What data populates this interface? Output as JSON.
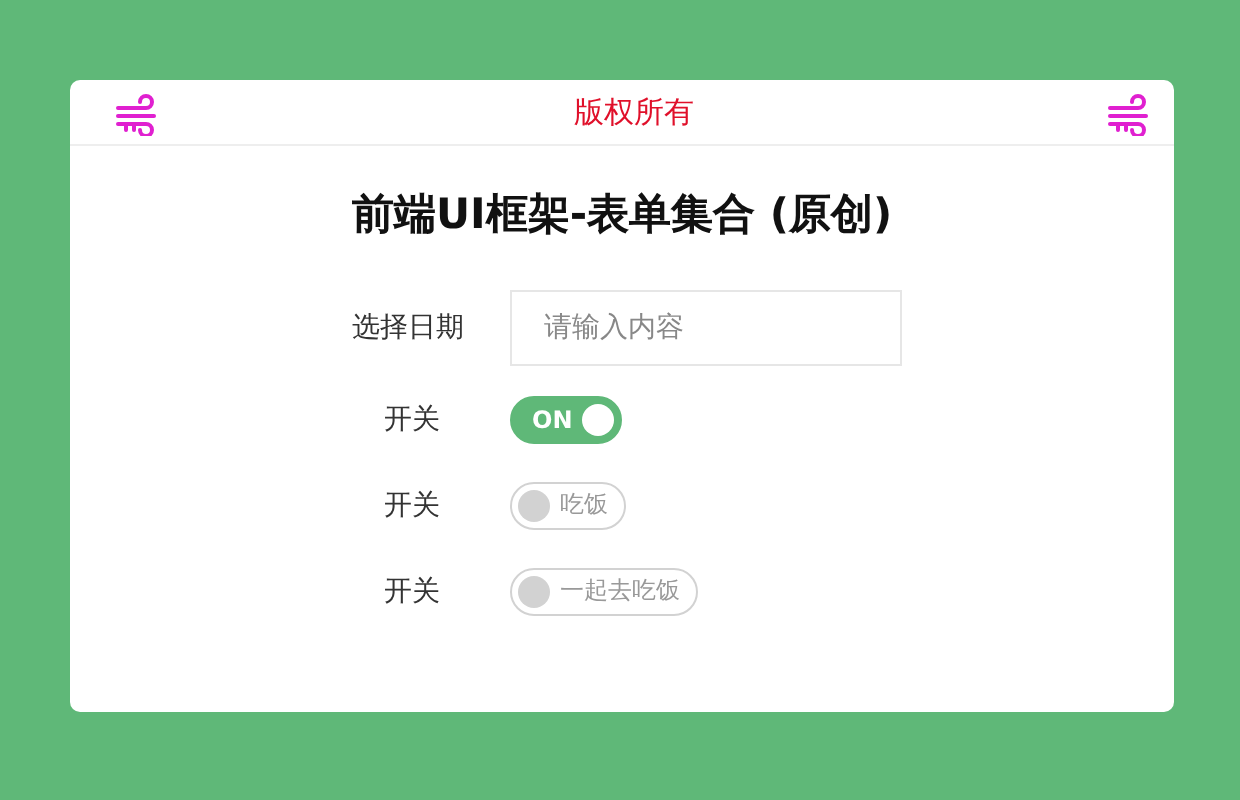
{
  "header": {
    "title": "版权所有"
  },
  "form": {
    "title": "前端UI框架-表单集合 (原创)",
    "rows": [
      {
        "kind": "input",
        "label": "选择日期",
        "placeholder": "请输入内容"
      },
      {
        "kind": "switch",
        "label": "开关",
        "text": "ON",
        "on": true
      },
      {
        "kind": "switch",
        "label": "开关",
        "text": "吃饭",
        "on": false
      },
      {
        "kind": "switch",
        "label": "开关",
        "text": "一起去吃饭",
        "on": false
      }
    ]
  }
}
